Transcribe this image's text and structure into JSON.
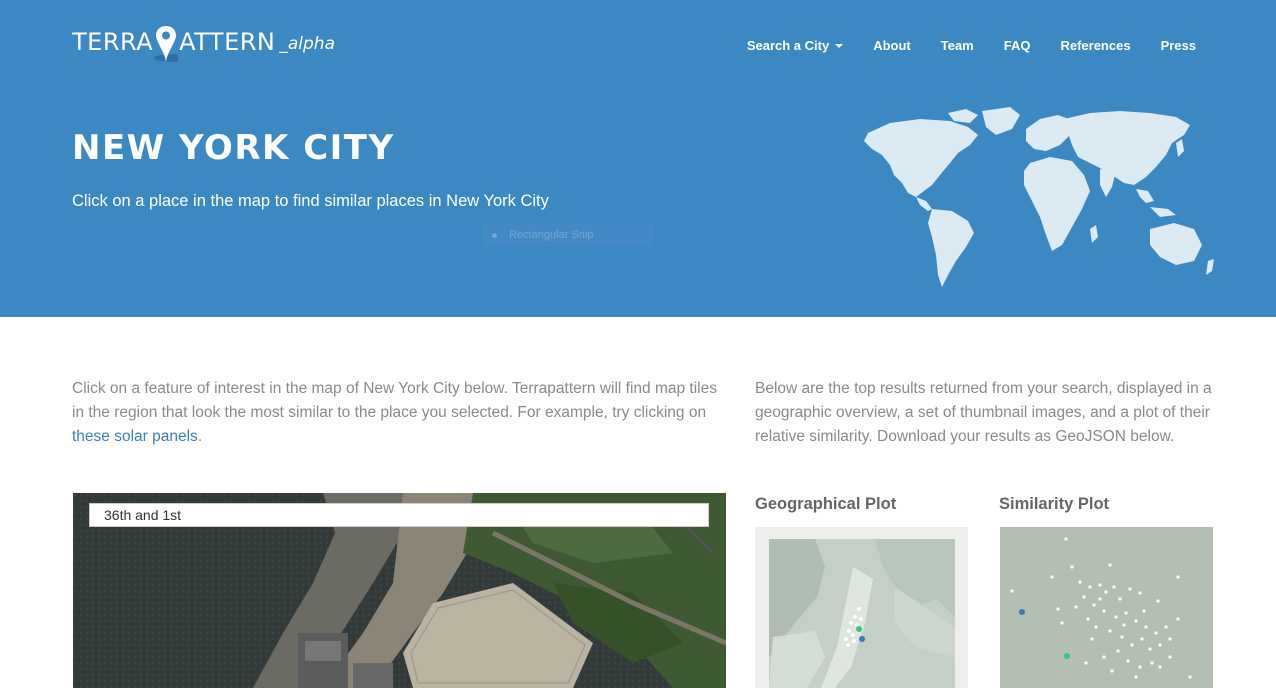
{
  "brand": {
    "main_left": "TERRA",
    "main_right": "ATTERN",
    "suffix": "_alpha"
  },
  "nav": {
    "search_city": "Search a City",
    "about": "About",
    "team": "Team",
    "faq": "FAQ",
    "references": "References",
    "press": "Press"
  },
  "hero": {
    "title": "NEW YORK CITY",
    "subtitle": "Click on a place in the map to find similar places in New York City",
    "overlay_label": "Rectangular Snip"
  },
  "intro": {
    "left_before_link": "Click on a feature of interest in the map of New York City below. Terrapattern will find map tiles in the region that look the most similar to the place you selected. For example, try clicking on ",
    "left_link": "these solar panels",
    "left_after_link": ".",
    "right": "Below are the top results returned from your search, displayed in a geographic overview, a set of thumbnail images, and a plot of their relative similarity. Download your results as GeoJSON below."
  },
  "map": {
    "search_value": "36th and 1st"
  },
  "plots": {
    "geographical_title": "Geographical Plot",
    "similarity_title": "Similarity Plot"
  },
  "colors": {
    "hero_bg": "#3c88c3",
    "world_land": "#dbeaf3",
    "link": "#3f7fb8",
    "marker_green": "#2ecc71",
    "marker_blue": "#3a78c0"
  },
  "icons": {
    "logo_pin": "map-pin-icon",
    "dropdown": "caret-down-icon"
  }
}
